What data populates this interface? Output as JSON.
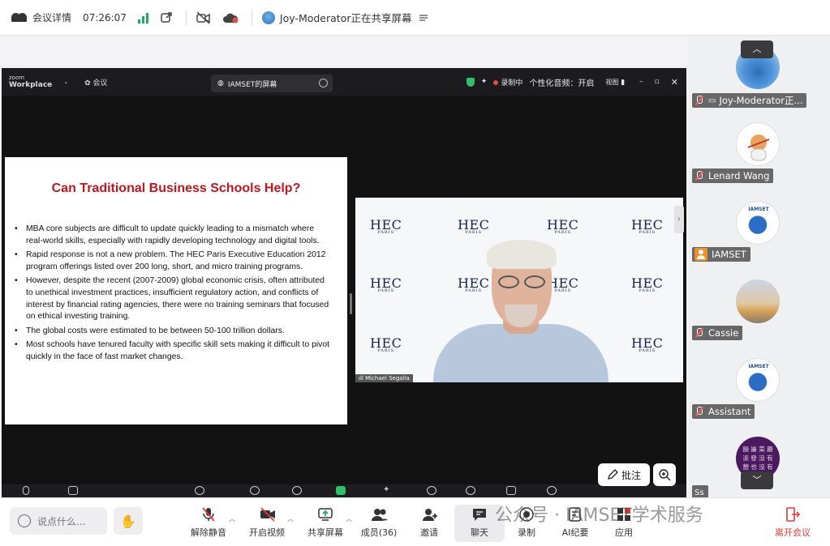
{
  "topbar": {
    "meeting_details": "会议详情",
    "time": "07:26:07",
    "sharing_status": "Joy-Moderator正在共享屏幕"
  },
  "zoom_window": {
    "logo_top": "zoom",
    "logo_bottom": "Workplace",
    "meeting_menu": "会议",
    "tab_title": "IAMSET的屏幕",
    "recording": "录制中",
    "audio_mode": "个性化音频：开启",
    "view": "视图"
  },
  "slide": {
    "title": "Can Traditional Business Schools Help?",
    "bullets": [
      "MBA core subjects are difficult to update quickly leading to a mismatch where real-world skills, especially with rapidly developing technology and digital tools.",
      "Rapid response is not a new problem. The HEC Paris Executive Education 2012 program offerings listed over 200 long, short, and micro training programs.",
      "However, despite the recent (2007-2009) global economic crisis, often attributed to unethical investment practices, insufficient regulatory action, and conflicts of interest by financial rating agencies, there were no training seminars that focused on ethical investing training.",
      "The global costs were estimated to be between 50-100 trillion dollars.",
      "Most schools have tenured faculty with specific skill sets making it difficult to pivot quickly in the face of fast market changes."
    ]
  },
  "video": {
    "brand": "HEC",
    "brand_sub": "PARIS",
    "speaker_name": "Michael Segalla"
  },
  "annotate_label": "批注",
  "participants": [
    {
      "name": "Joy-Moderator正..."
    },
    {
      "name": "Lenard Wang"
    },
    {
      "name": "IAMSET",
      "logo_text": "IAMSET"
    },
    {
      "name": "Cassie"
    },
    {
      "name": "Assistant",
      "logo_text": "IAMSET"
    },
    {
      "name": "Ss",
      "avatar_text": "韻 論 菜 趣 派 發 沒 有 憩 也 沒 有"
    }
  ],
  "toolbar": {
    "chat_placeholder": "说点什么...",
    "unmute": "解除静音",
    "start_video": "开启视频",
    "share_screen": "共享屏幕",
    "members": "成员(36)",
    "invite": "邀请",
    "chat": "聊天",
    "record": "录制",
    "ai_notes": "AI纪要",
    "apps": "应用",
    "leave": "离开会议"
  },
  "watermark": "公众号 · IAMSET学术服务",
  "colors": {
    "slide_title": "#c0161e",
    "leave": "#e53935",
    "signal": "#1aae5e",
    "muted": "#ff5b5b"
  }
}
